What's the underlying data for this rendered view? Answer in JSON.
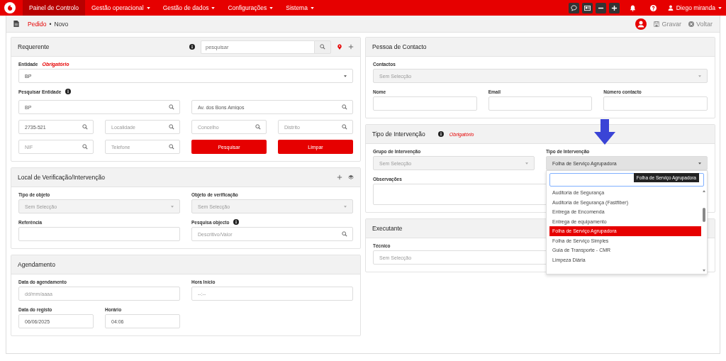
{
  "navbar": {
    "items": [
      {
        "label": "Painel de Controlo",
        "selected": true,
        "caret": false
      },
      {
        "label": "Gestão operacional",
        "selected": false,
        "caret": true
      },
      {
        "label": "Gestão de dados",
        "selected": false,
        "caret": true
      },
      {
        "label": "Configurações",
        "selected": false,
        "caret": true
      },
      {
        "label": "Sistema",
        "selected": false,
        "caret": true
      }
    ],
    "tools": [
      {
        "kind": "chat"
      },
      {
        "kind": "card"
      },
      {
        "kind": "minus"
      },
      {
        "kind": "plus"
      }
    ],
    "user": "Diego miranda"
  },
  "breadcrumb": {
    "link": "Pedido",
    "separator": "•",
    "current": "Novo"
  },
  "actions": [
    {
      "kind": "save",
      "label": "Gravar"
    },
    {
      "kind": "back",
      "label": "Voltar"
    }
  ],
  "columns": [
    [
      {
        "title": "Requerente",
        "tools": [
          {
            "kind": "info"
          },
          {
            "kind": "search",
            "placeholder": "pesquisar"
          },
          {
            "kind": "pin"
          },
          {
            "kind": "plus"
          }
        ],
        "rows": [
          [
            {
              "kind": "select",
              "label": "Entidade",
              "required": "Obrigatório",
              "value": "BP",
              "colspan": 4
            }
          ],
          [
            {
              "kind": "heading",
              "label": "Pesquisar Entidade",
              "info": true,
              "colspan": 4
            }
          ],
          [
            {
              "kind": "input",
              "value": "BP",
              "search": true,
              "colspan": 2
            },
            {
              "kind": "input",
              "value": "Av. dos Bons Amigos",
              "search": true,
              "colspan": 2
            }
          ],
          [
            {
              "kind": "input",
              "value": "2735-521",
              "search": true
            },
            {
              "kind": "input",
              "placeholder": "Localidade",
              "search": true
            },
            {
              "kind": "input",
              "placeholder": "Concelho",
              "search": true
            },
            {
              "kind": "input",
              "placeholder": "Distrito",
              "search": true
            }
          ],
          [
            {
              "kind": "input",
              "placeholder": "NIF",
              "search": true
            },
            {
              "kind": "input",
              "placeholder": "Telefone",
              "search": true
            },
            {
              "kind": "button",
              "label": "Pesquisar"
            },
            {
              "kind": "button",
              "label": "Limpar"
            }
          ]
        ]
      },
      {
        "title": "Local de Verificação/Intervenção",
        "tools": [
          {
            "kind": "plus"
          },
          {
            "kind": "layers"
          }
        ],
        "rows": [
          [
            {
              "kind": "select",
              "label": "Tipo de objeto",
              "placeholder": "Sem Selecção",
              "disabled": true
            },
            {
              "kind": "select",
              "label": "Objeto de verificação",
              "placeholder": "Sem Selecção",
              "disabled": true
            }
          ],
          [
            {
              "kind": "input",
              "label": "Referência"
            },
            {
              "kind": "input",
              "label": "Pesquisa objecto",
              "info": true,
              "placeholder": "Descritivo/Valor",
              "search": true
            }
          ]
        ]
      },
      {
        "title": "Agendamento",
        "rows": [
          [
            {
              "kind": "input",
              "label": "Data do agendamento",
              "placeholder": "dd/mm/aaaa",
              "colspan": 2
            },
            {
              "kind": "input",
              "label": "Hora Início",
              "placeholder": "--:--",
              "colspan": 2
            }
          ],
          [
            {
              "kind": "input",
              "label": "Data do registo",
              "value": "06/06/2025"
            },
            {
              "kind": "input",
              "label": "Horário",
              "value": "04:06"
            }
          ]
        ]
      }
    ],
    [
      {
        "title": "Pessoa de Contacto",
        "rows": [
          [
            {
              "kind": "select",
              "label": "Contactos",
              "placeholder": "Sem Selecção",
              "disabled": true,
              "colspan": 3
            }
          ],
          [
            {
              "kind": "input",
              "label": "Nome"
            },
            {
              "kind": "input",
              "label": "Email"
            },
            {
              "kind": "input",
              "label": "Número contacto"
            }
          ]
        ]
      },
      {
        "title": "Tipo de Intervenção",
        "tools": [
          {
            "kind": "info"
          },
          {
            "kind": "required",
            "text": "Obrigatório"
          }
        ],
        "rows": [
          [
            {
              "kind": "select",
              "label": "Grupo de Intervenção",
              "placeholder": "Sem Selecção",
              "disabled": true
            },
            {
              "kind": "select",
              "label": "Tipo de Intervenção",
              "value": "Folha de Serviço Agrupadora",
              "open": true
            }
          ],
          [
            {
              "kind": "textarea",
              "label": "Observações",
              "colspan": 2
            }
          ]
        ],
        "dropdown": {
          "tooltip": "Folha de Serviço Agrupadora",
          "options": [
            {
              "label": "Auditoria de Segurança",
              "selected": false
            },
            {
              "label": "Auditoria de Segurança (Fastfiber)",
              "selected": false
            },
            {
              "label": "Entrega de Encomenda",
              "selected": false
            },
            {
              "label": "Entrega de equipamento",
              "selected": false
            },
            {
              "label": "Folha de Serviço Agrupadora",
              "selected": true
            },
            {
              "label": "Folha de Serviço Simples",
              "selected": false
            },
            {
              "label": "Guia de Transporte - CMR",
              "selected": false
            },
            {
              "label": "Limpeza Diária",
              "selected": false
            }
          ]
        }
      },
      {
        "title": "Executante",
        "rows": [
          [
            {
              "kind": "select",
              "label": "Técnico",
              "placeholder": "Sem Selecção"
            }
          ]
        ]
      }
    ]
  ]
}
